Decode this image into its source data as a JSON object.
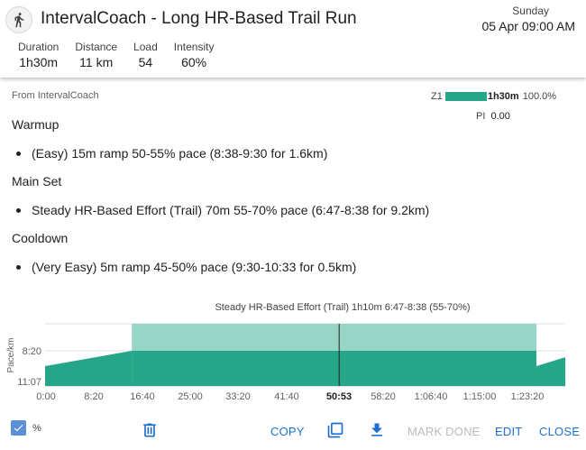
{
  "header": {
    "title": "IntervalCoach - Long HR-Based Trail Run",
    "day": "Sunday",
    "datetime": "05 Apr 09:00 AM",
    "stats": [
      {
        "label": "Duration",
        "value": "1h30m"
      },
      {
        "label": "Distance",
        "value": "11 km"
      },
      {
        "label": "Load",
        "value": "54"
      },
      {
        "label": "Intensity",
        "value": "60%"
      }
    ]
  },
  "source": "From IntervalCoach",
  "zones": {
    "zone": "Z1",
    "duration": "1h30m",
    "percent": "100.0%",
    "fraction": 1.0,
    "pi_label": "PI",
    "pi_value": "0.00"
  },
  "sections": [
    {
      "title": "Warmup",
      "step": "(Easy) 15m ramp 50-55% pace (8:38-9:30 for 1.6km)"
    },
    {
      "title": "Main Set",
      "step": "Steady HR-Based Effort (Trail) 70m 55-70% pace (6:47-8:38 for 9.2km)"
    },
    {
      "title": "Cooldown",
      "step": "(Very Easy) 5m ramp 45-50% pace (9:30-10:33 for 0.5km)"
    }
  ],
  "chart_data": {
    "type": "area",
    "title": "Steady HR-Based Effort (Trail)  1h10m  6:47-8:38 (55-70%)",
    "ylabel": "Pace/km",
    "y_ticks": [
      "8:20",
      "11:07"
    ],
    "x_ticks": [
      "0:00",
      "8:20",
      "16:40",
      "25:00",
      "33:20",
      "41:40",
      "50:53",
      "58:20",
      "1:06:40",
      "1:15:00",
      "1:23:20"
    ],
    "x_range_min": [
      0,
      90
    ],
    "cursor_label": "50:53",
    "cursor_min": 50.88,
    "highlight": {
      "label": "Steady HR-Based Effort (Trail)",
      "start_min": 15,
      "end_min": 85
    },
    "segments": [
      {
        "name": "Warmup",
        "start_min": 0,
        "end_min": 15,
        "pace_start": "11:07",
        "pace_end": "8:20"
      },
      {
        "name": "Main Set",
        "start_min": 15,
        "end_min": 85,
        "pace_start": "8:20",
        "pace_end": "8:20"
      },
      {
        "name": "Cooldown",
        "start_min": 85,
        "end_min": 90,
        "pace_start": "11:07",
        "pace_end": "9:30"
      }
    ]
  },
  "colors": {
    "area": "#26a688",
    "highlight": "#97d6c6",
    "primary_button": "#1e6fd1",
    "disabled_button": "#bcbcbc",
    "checkbox": "#5b8fd6"
  },
  "footer": {
    "percent_label": "%",
    "percent_checked": true,
    "delete_icon": "trash-icon",
    "copy": "COPY",
    "duplicate_icon": "copy-stack-icon",
    "download_icon": "download-icon",
    "mark_done": "MARK DONE",
    "edit": "EDIT",
    "close": "CLOSE"
  }
}
